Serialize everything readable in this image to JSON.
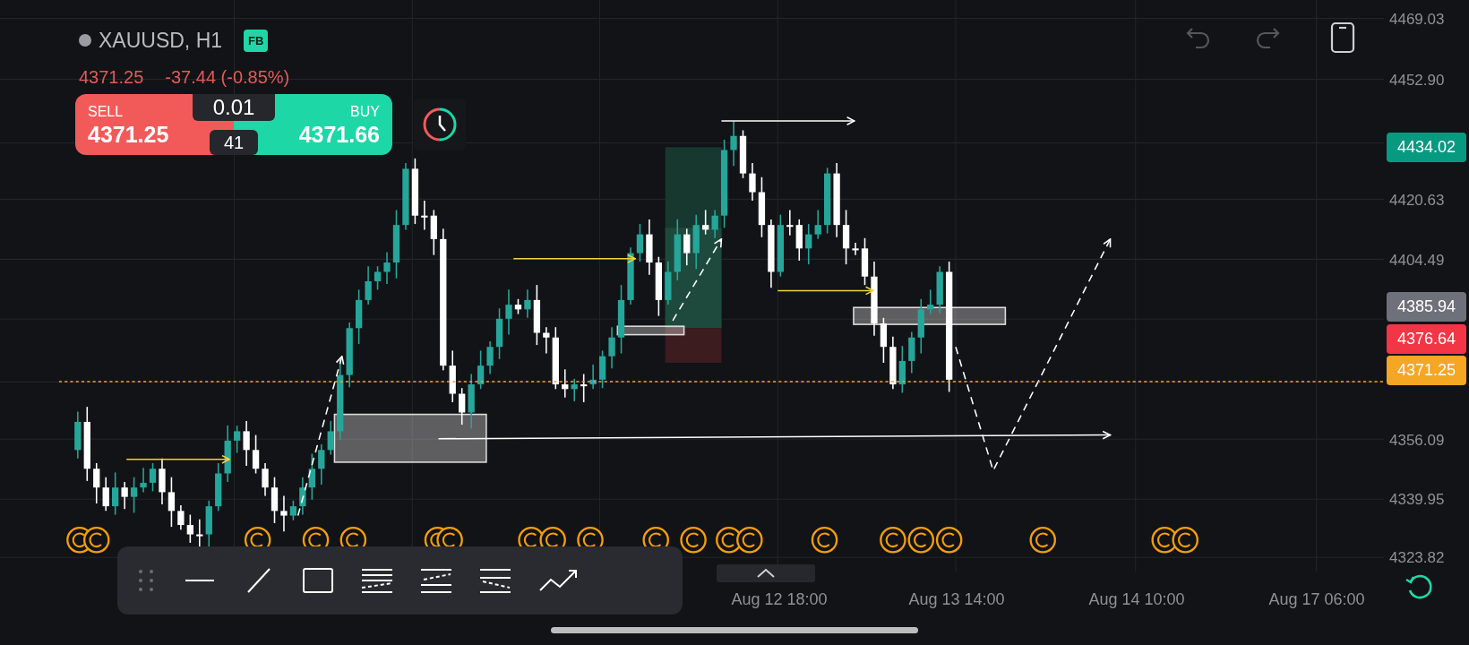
{
  "header": {
    "symbol": "XAUUSD, H1",
    "badge": "FB",
    "price": "4371.25",
    "change": "-37.44 (-0.85%)"
  },
  "trade_panel": {
    "sell_label": "SELL",
    "sell_price": "4371.25",
    "lot": "0.01",
    "spread": "41",
    "buy_label": "BUY",
    "buy_price": "4371.66"
  },
  "price_axis": {
    "ticks": [
      "4469.03",
      "4452.90",
      "4420.63",
      "4404.49",
      "4356.09",
      "4339.95",
      "4323.82"
    ],
    "price_labels": [
      {
        "text": "4434.02",
        "color": "#089981"
      },
      {
        "text": "4385.94",
        "color": "#6f717a"
      },
      {
        "text": "4376.64",
        "color": "#f23645"
      },
      {
        "text": "4371.25",
        "color": "#f5a623"
      }
    ]
  },
  "time_axis": {
    "labels": [
      "Aug 12 18:00",
      "Aug 13 14:00",
      "Aug 14 10:00",
      "Aug 17 06:00"
    ]
  }
}
